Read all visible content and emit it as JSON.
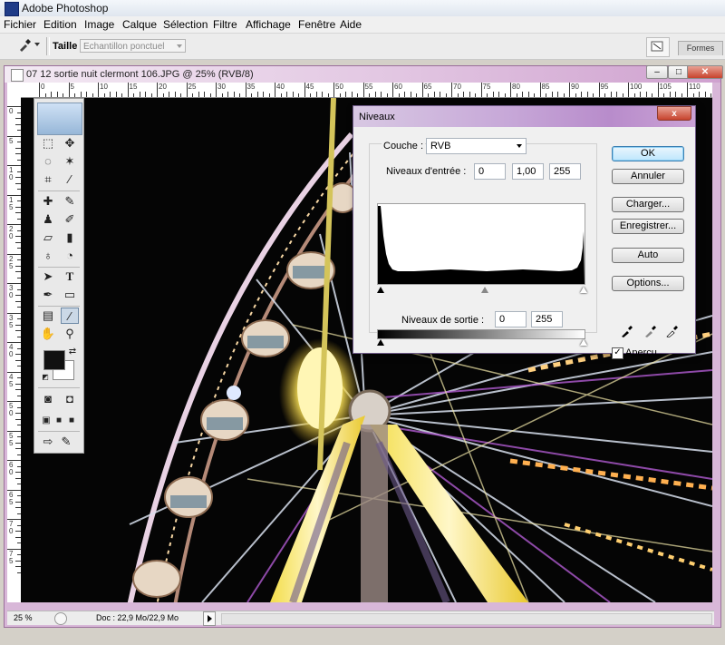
{
  "app": {
    "title": "Adobe Photoshop"
  },
  "menu": [
    "Fichier",
    "Edition",
    "Image",
    "Calque",
    "Sélection",
    "Filtre",
    "Affichage",
    "Fenêtre",
    "Aide"
  ],
  "options_bar": {
    "size_label": "Taille :",
    "size_value": "Echantillon ponctuel",
    "panel_tab": "Formes"
  },
  "document": {
    "title": "07 12 sortie nuit clermont 106.JPG @ 25% (RVB/8)",
    "hruler_labels": [
      "0",
      "5",
      "10",
      "15",
      "20",
      "25",
      "30",
      "35",
      "40",
      "45",
      "50",
      "55",
      "60",
      "65",
      "70",
      "75",
      "80",
      "85",
      "90",
      "95",
      "100",
      "105",
      "110",
      "115"
    ],
    "vruler_labels": [
      "0",
      "5",
      "1 0",
      "1 5",
      "2 0",
      "2 5",
      "3 0",
      "3 5",
      "4 0",
      "4 5",
      "5 0",
      "5 5",
      "6 0",
      "6 5",
      "7 0",
      "7 5"
    ]
  },
  "status": {
    "zoom": "25 %",
    "doc": "Doc : 22,9 Mo/22,9 Mo"
  },
  "levels": {
    "title": "Niveaux",
    "close": "x",
    "channel_label": "Couche :",
    "channel_value": "RVB",
    "input_label": "Niveaux d'entrée :",
    "input_black": "0",
    "input_gamma": "1,00",
    "input_white": "255",
    "output_label": "Niveaux de sortie :",
    "output_black": "0",
    "output_white": "255",
    "buttons": {
      "ok": "OK",
      "cancel": "Annuler",
      "load": "Charger...",
      "save": "Enregistrer...",
      "auto": "Auto",
      "options": "Options..."
    },
    "preview_label": "Aperçu",
    "preview_checked": true
  }
}
